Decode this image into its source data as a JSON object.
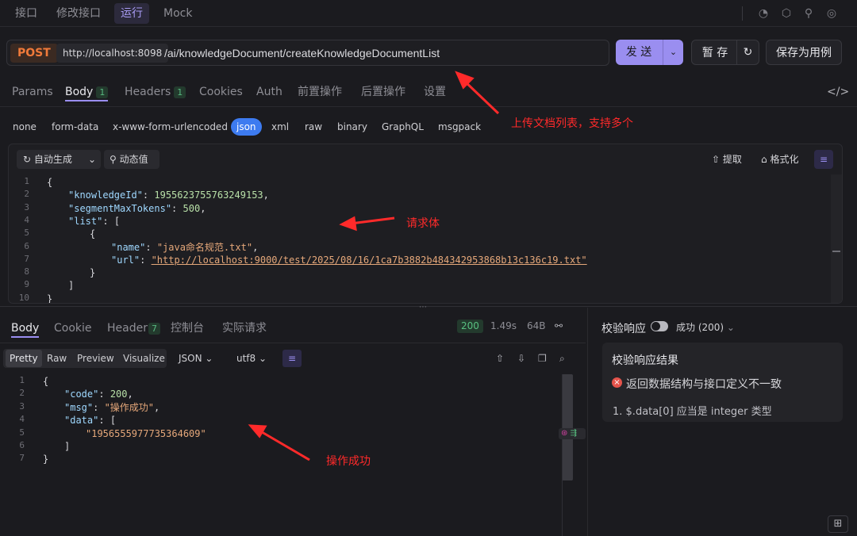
{
  "top_tabs": [
    "接口",
    "修改接口",
    "运行",
    "Mock"
  ],
  "request": {
    "method": "POST",
    "host": "http://localhost:8098",
    "path": "/ai/knowledgeDocument/createKnowledgeDocumentList",
    "send_label": "发 送",
    "save_label": "暂 存",
    "save_as_label": "保存为用例"
  },
  "request_tabs": [
    {
      "label": "Params"
    },
    {
      "label": "Body",
      "badge": "1"
    },
    {
      "label": "Headers",
      "badge": "1"
    },
    {
      "label": "Cookies"
    },
    {
      "label": "Auth"
    },
    {
      "label": "前置操作"
    },
    {
      "label": "后置操作"
    },
    {
      "label": "设置"
    }
  ],
  "body_types": [
    "none",
    "form-data",
    "x-www-form-urlencoded",
    "json",
    "xml",
    "raw",
    "binary",
    "GraphQL",
    "msgpack"
  ],
  "editor_toolbar": {
    "auto_generate": "自动生成",
    "dynamic_value": "动态值",
    "extract": "提取",
    "format": "格式化"
  },
  "request_body_lines": [
    {
      "n": "1",
      "text": "{"
    },
    {
      "n": "2",
      "key": "\"knowledgeId\"",
      "val": "1955623755763249153",
      "vt": "num",
      "tail": ","
    },
    {
      "n": "3",
      "key": "\"segmentMaxTokens\"",
      "val": "500",
      "vt": "num",
      "tail": ","
    },
    {
      "n": "4",
      "key": "\"list\"",
      "val": "[",
      "vt": "punc"
    },
    {
      "n": "5",
      "text": "{"
    },
    {
      "n": "6",
      "key": "\"name\"",
      "val": "\"java命名规范.txt\"",
      "vt": "str",
      "tail": ","
    },
    {
      "n": "7",
      "key": "\"url\"",
      "val": "\"http://localhost:9000/test/2025/08/16/1ca7b3882b484342953868b13c136c19.txt\"",
      "vt": "url"
    },
    {
      "n": "8",
      "text": "}"
    },
    {
      "n": "9",
      "text": "]"
    },
    {
      "n": "10",
      "text": "}"
    }
  ],
  "annotations": {
    "upload_list": "上传文档列表，支持多个",
    "request_body": "请求体",
    "success": "操作成功"
  },
  "response_tabs": [
    {
      "label": "Body"
    },
    {
      "label": "Cookie"
    },
    {
      "label": "Header",
      "badge": "7"
    },
    {
      "label": "控制台"
    },
    {
      "label": "实际请求"
    }
  ],
  "response_meta": {
    "status": "200",
    "time": "1.49s",
    "size": "64B"
  },
  "response_view_modes": [
    "Pretty",
    "Raw",
    "Preview",
    "Visualize"
  ],
  "response_format": "JSON",
  "response_encoding": "utf8",
  "response_body_lines": [
    {
      "n": "1",
      "text": "{"
    },
    {
      "n": "2",
      "key": "\"code\"",
      "val": "200",
      "vt": "num",
      "tail": ","
    },
    {
      "n": "3",
      "key": "\"msg\"",
      "val": "\"操作成功\"",
      "vt": "str",
      "tail": ","
    },
    {
      "n": "4",
      "key": "\"data\"",
      "val": "[",
      "vt": "punc"
    },
    {
      "n": "5",
      "text": "\"1956555977735364609\"",
      "tt": "str"
    },
    {
      "n": "6",
      "text": "]"
    },
    {
      "n": "7",
      "text": "}"
    }
  ],
  "validation": {
    "label": "校验响应",
    "status": "成功 (200)",
    "title": "校验响应结果",
    "error": "返回数据结构与接口定义不一致",
    "detail": "1. $.data[0] 应当是 integer 类型"
  },
  "colors": {
    "accent": "#9a8ef0",
    "method": "#f07a3a",
    "annotation": "#ff2a2a",
    "success": "#58c080",
    "error": "#e5534b"
  }
}
